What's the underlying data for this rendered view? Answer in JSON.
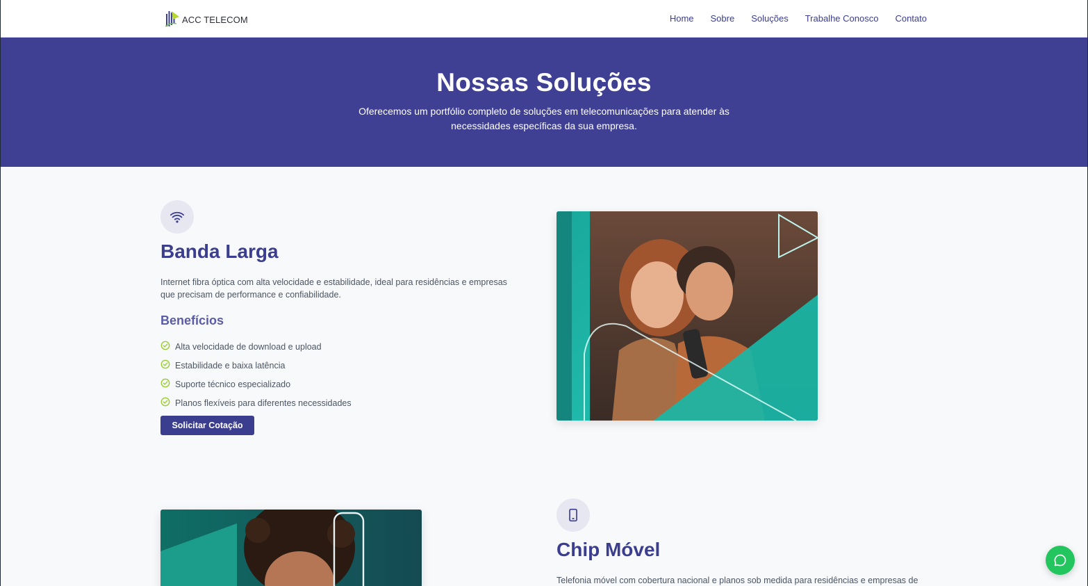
{
  "brand": {
    "name": "ACC TELECOM"
  },
  "nav": {
    "items": [
      {
        "label": "Home"
      },
      {
        "label": "Sobre"
      },
      {
        "label": "Soluções"
      },
      {
        "label": "Trabalhe Conosco"
      },
      {
        "label": "Contato"
      }
    ]
  },
  "hero": {
    "title": "Nossas Soluções",
    "subtitle": "Oferecemos um portfólio completo de soluções em telecomunicações para atender às necessidades específicas da sua empresa."
  },
  "sections": [
    {
      "icon": "wifi-icon",
      "title": "Banda Larga",
      "description": "Internet fibra óptica com alta velocidade e estabilidade, ideal para residências e empresas que precisam de performance e confiabilidade.",
      "benefits_title": "Benefícios",
      "benefits": [
        "Alta velocidade de download e upload",
        "Estabilidade e baixa latência",
        "Suporte técnico especializado",
        "Planos flexíveis para diferentes necessidades"
      ],
      "cta": "Solicitar Cotação"
    },
    {
      "icon": "smartphone-icon",
      "title": "Chip Móvel",
      "description": "Telefonia móvel com cobertura nacional e planos sob medida para residências e empresas de"
    }
  ],
  "colors": {
    "primary": "#3b3d8f",
    "hero_bg": "#3f3f94",
    "check": "#9acd32",
    "chat": "#22c55e"
  }
}
